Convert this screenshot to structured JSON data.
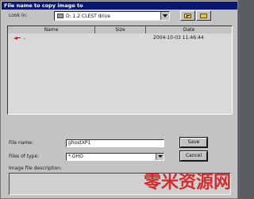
{
  "dialog": {
    "title": "File name to copy image to"
  },
  "look_in": {
    "label": "Look in:",
    "value": "D: 1.2 CLEST drive"
  },
  "list": {
    "columns": [
      "Name",
      "Size",
      "Date"
    ],
    "rows": [
      {
        "name": "..",
        "size": "",
        "date": "2004-10-03 11:46:44"
      }
    ]
  },
  "filename": {
    "label": "File name:",
    "value": "ghostXP1",
    "save_label": "Save"
  },
  "filetype": {
    "label": "Files of type:",
    "value": "*.GHO",
    "cancel_label": "Cancel"
  },
  "description": {
    "label": "Image file description:",
    "value": ""
  },
  "watermark": {
    "text": "零米资源网"
  },
  "colors": {
    "titlebar": "#0b1673",
    "window": "#c3c3c3",
    "watermark": "#d21c1c"
  },
  "icons": {
    "drive": "drive-icon",
    "up_folder": "up-folder-icon",
    "new_folder": "new-folder-icon",
    "parent": "parent-arrow-icon"
  }
}
